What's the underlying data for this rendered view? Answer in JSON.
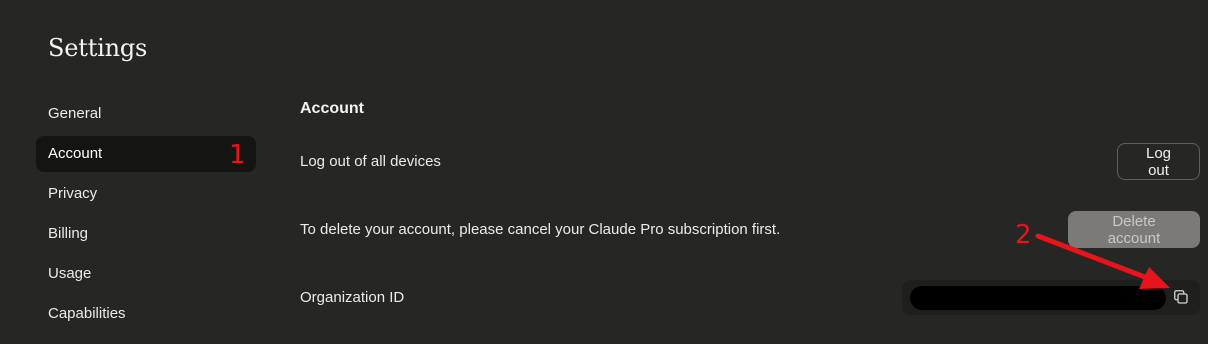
{
  "page": {
    "title": "Settings"
  },
  "sidebar": {
    "items": [
      {
        "label": "General",
        "active": false
      },
      {
        "label": "Account",
        "active": true
      },
      {
        "label": "Privacy",
        "active": false
      },
      {
        "label": "Billing",
        "active": false
      },
      {
        "label": "Usage",
        "active": false
      },
      {
        "label": "Capabilities",
        "active": false
      }
    ]
  },
  "account": {
    "section_title": "Account",
    "logout_row_label": "Log out of all devices",
    "logout_button": "Log out",
    "delete_row_label": "To delete your account, please cancel your Claude Pro subscription first.",
    "delete_button": "Delete account",
    "delete_button_disabled": true,
    "org_id_label": "Organization ID",
    "org_id_value_redacted": true,
    "copy_icon": "copy-icon"
  },
  "annotations": {
    "marker_1": "1",
    "marker_2": "2",
    "color": "#e8141b"
  },
  "colors": {
    "background": "#262624",
    "active_item_bg": "#141413",
    "disabled_button_bg": "#7b7a76"
  }
}
